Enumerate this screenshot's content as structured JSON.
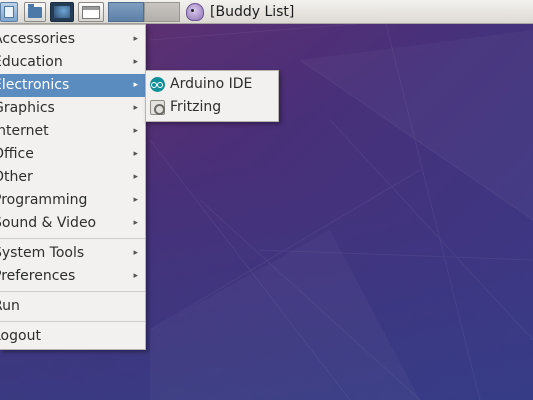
{
  "panel": {
    "task_label": "[Buddy List]",
    "launchers": [
      "menu-icon",
      "file-manager-icon",
      "terminal-icon",
      "show-desktop-icon"
    ],
    "workspaces": [
      "workspace-1",
      "workspace-2"
    ]
  },
  "menu": {
    "items": [
      {
        "label": "Accessories",
        "arrow": "▸"
      },
      {
        "label": "Education",
        "arrow": "▸"
      },
      {
        "label": "Electronics",
        "arrow": "▸",
        "highlighted": true
      },
      {
        "label": "Graphics",
        "arrow": "▸"
      },
      {
        "label": "Internet",
        "arrow": "▸"
      },
      {
        "label": "Office",
        "arrow": "▸"
      },
      {
        "label": "Other",
        "arrow": "▸"
      },
      {
        "label": "Programming",
        "arrow": "▸"
      },
      {
        "label": "Sound & Video",
        "arrow": "▸"
      },
      {
        "label": "System Tools",
        "arrow": "▸"
      },
      {
        "label": "Preferences",
        "arrow": "▸"
      },
      {
        "label": "Run"
      },
      {
        "label": "Logout"
      }
    ]
  },
  "submenu": {
    "items": [
      {
        "label": "Arduino IDE",
        "icon": "arduino-icon"
      },
      {
        "label": "Fritzing",
        "icon": "fritzing-icon"
      }
    ]
  },
  "colors": {
    "highlight": "#5a8cc0",
    "menu_bg": "#f2f1f0",
    "desktop": "#4a2d72"
  }
}
